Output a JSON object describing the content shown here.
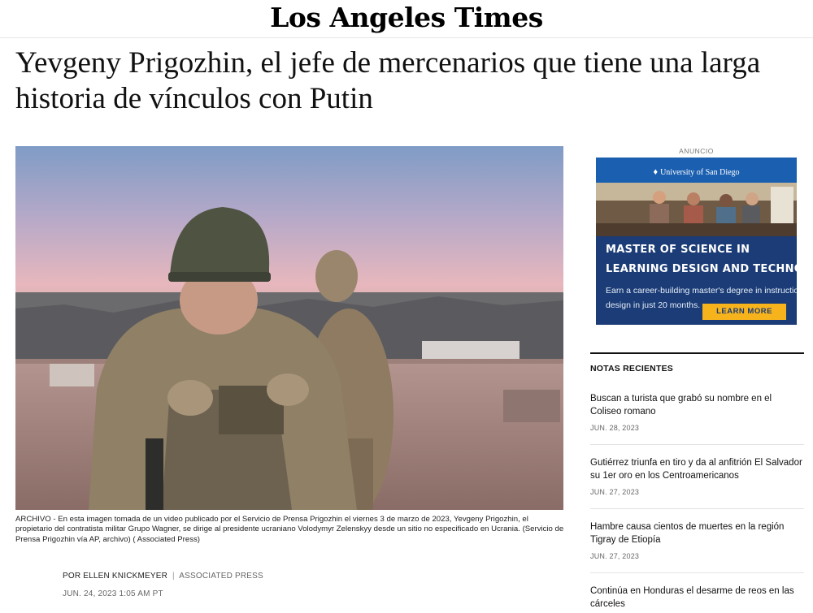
{
  "masthead": {
    "logo": "Los Angeles Times"
  },
  "article": {
    "headline": "Yevgeny Prigozhin, el jefe de mercenarios que tiene una larga historia de vínculos con Putin",
    "caption": "ARCHIVO - En esta imagen tomada de un video publicado por el Servicio de Prensa Prigozhin el viernes 3 de marzo de 2023, Yevgeny Prigozhin, el propietario del contratista militar Grupo Wagner, se dirige al presidente ucraniano Volodymyr Zelenskyy desde un sitio no especificado en Ucrania. (Servicio de Prensa Prigozhin vía AP, archivo) ( Associated Press)",
    "byline_prefix": "POR",
    "author": "ELLEN KNICKMEYER",
    "separator": "|",
    "agency": "ASSOCIATED PRESS",
    "date": "JUN. 24, 2023 1:05 AM PT"
  },
  "ad": {
    "label": "ANUNCIO",
    "university": "University of San Diego",
    "title_line1": "MASTER OF SCIENCE IN",
    "title_line2": "LEARNING DESIGN AND TECHNOLOGY",
    "desc_line1": "Earn a career-building master's degree in instructional",
    "desc_line2": "design in just 20 months.",
    "cta": "LEARN MORE"
  },
  "recent": {
    "heading": "NOTAS RECIENTES",
    "items": [
      {
        "title": "Buscan a turista que grabó su nombre en el Coliseo romano",
        "date": "JUN. 28, 2023"
      },
      {
        "title": "Gutiérrez triunfa en tiro y da al anfitrión El Salvador su 1er oro en los Centroamericanos",
        "date": "JUN. 27, 2023"
      },
      {
        "title": "Hambre causa cientos de muertes en la región Tigray de Etiopía",
        "date": "JUN. 27, 2023"
      },
      {
        "title": "Continúa en Honduras el desarme de reos en las cárceles",
        "date": ""
      }
    ]
  }
}
